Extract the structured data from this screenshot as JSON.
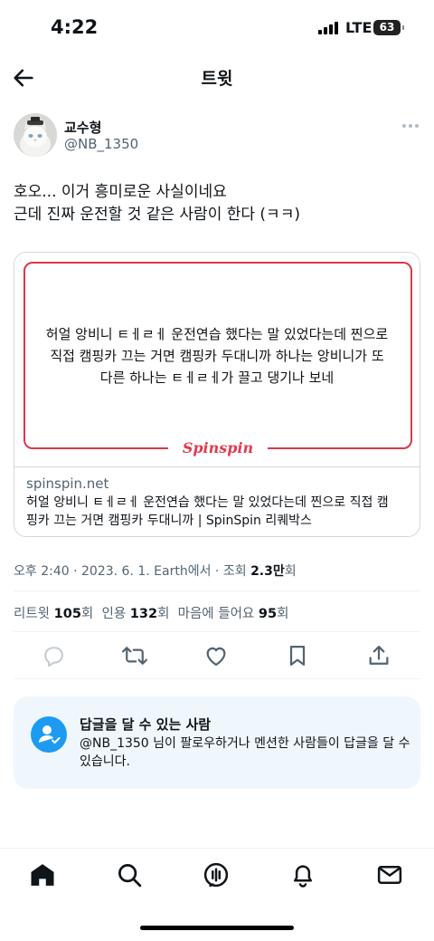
{
  "status_bar": {
    "time": "4:22",
    "network": "LTE",
    "battery": "63"
  },
  "nav": {
    "title": "트윗"
  },
  "author": {
    "display_name": "교수형",
    "handle": "@NB_1350"
  },
  "tweet": {
    "lines": [
      "호오... 이거 흥미로운 사실이네요",
      "근데 진짜 운전할 것 같은 사람이 한다 (ㅋㅋ)"
    ]
  },
  "card": {
    "image_text_lines": [
      "허얼 앙비니 ㅌㅔㄹㅔ 운전연습 했다는 말 있었다는데 찐으로",
      "직접 캠핑카 끄는 거면 캠핑카 두대니까 하나는 앙비니가 또",
      "다른 하나는 ㅌㅔㄹㅔ가 끌고 댕기나 보네"
    ],
    "brand_logo": "Spinspin",
    "domain": "spinspin.net",
    "description_lines": [
      "허얼 앙비니 ㅌㅔㄹㅔ 운전연습 했다는 말 있었다는데 찐으로 직접 캠",
      "핑카 끄는 거면 캠핑카 두대니까 | SpinSpin 리퀘박스"
    ],
    "accent_color": "#d9394b"
  },
  "meta": {
    "time": "오후 2:40",
    "date": "2023. 6. 1.",
    "source": "Earth에서",
    "views_label": "조회",
    "views_value": "2.3만",
    "views_unit": "회"
  },
  "stats": {
    "retweets_label": "리트윗",
    "retweets_value": "105",
    "quotes_label": "인용",
    "quotes_value": "132",
    "likes_label": "마음에 들어요",
    "likes_value": "95",
    "unit": "회"
  },
  "actions": {
    "icons": [
      "reply-icon",
      "retweet-icon",
      "like-icon",
      "bookmark-icon",
      "share-icon"
    ]
  },
  "reply_restriction": {
    "title": "답글을 달 수 있는 사람",
    "description_lines": [
      "@NB_1350 님이 팔로우하거나 멘션한 사람들이 답글을 달 수",
      "있습니다."
    ],
    "accent_color": "#1d9bf0"
  },
  "tabbar": {
    "icons": [
      "home-icon",
      "search-icon",
      "spaces-icon",
      "notifications-icon",
      "messages-icon"
    ]
  }
}
